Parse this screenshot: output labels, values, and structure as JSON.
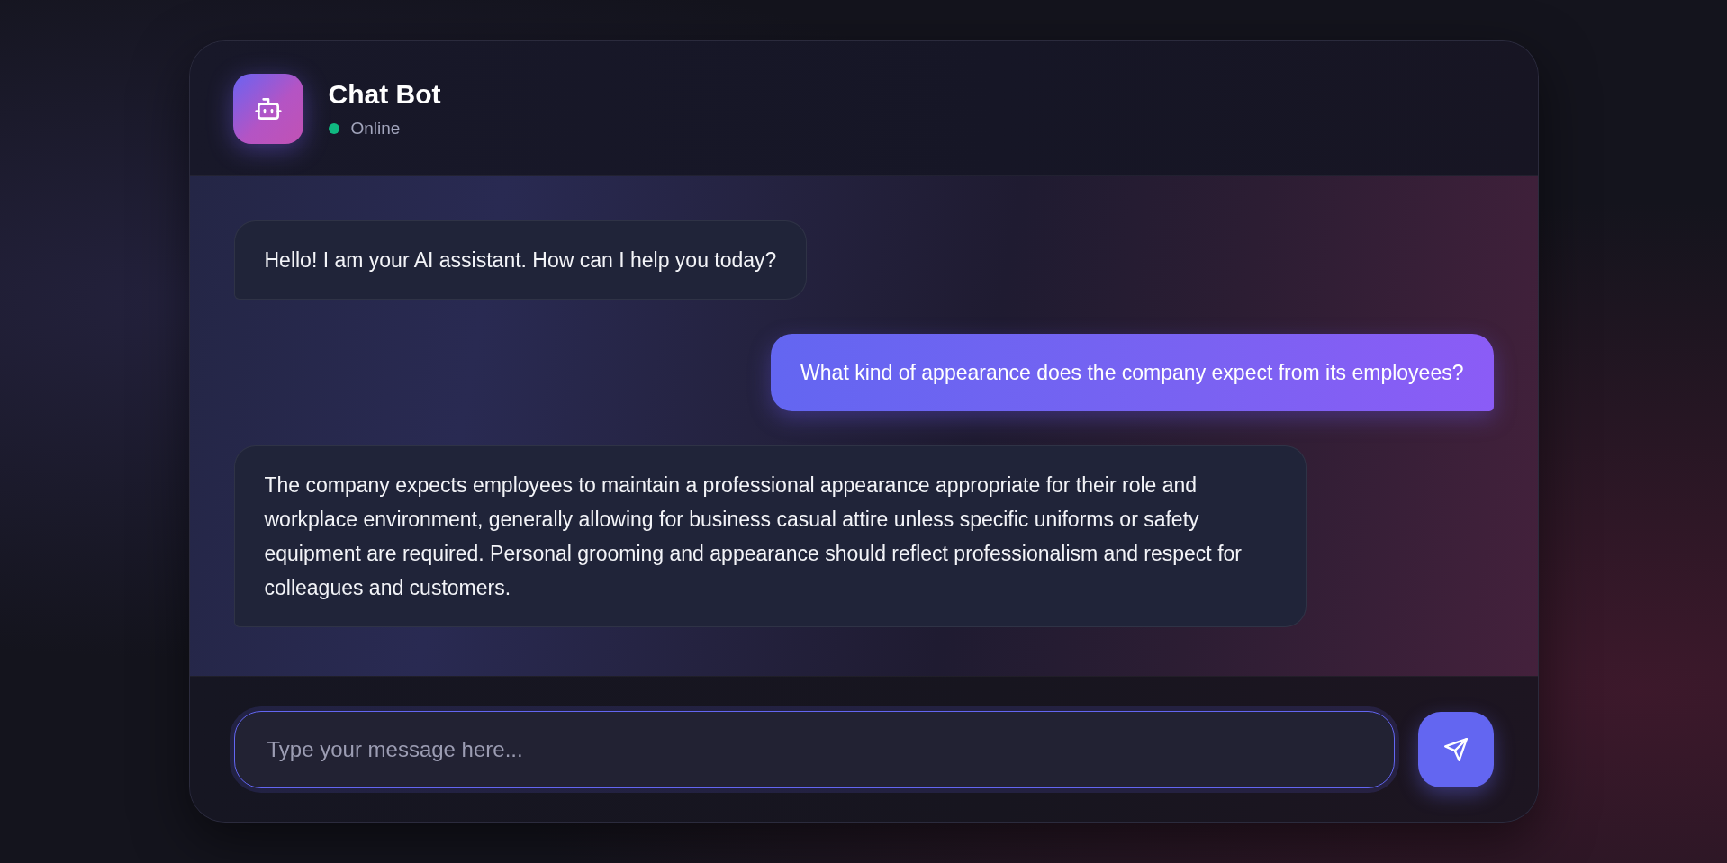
{
  "header": {
    "title": "Chat Bot",
    "status": {
      "label": "Online",
      "online": true
    }
  },
  "messages": [
    {
      "kind": "bot",
      "text": "Hello! I am your AI assistant. How can I help you today?"
    },
    {
      "kind": "user",
      "text": "What kind of appearance does the company expect from its employees?"
    },
    {
      "kind": "bot",
      "text": "The company expects employees to maintain a professional appearance appropriate for their role and workplace environment, generally allowing for business casual attire unless specific uniforms or safety equipment are required. Personal grooming and appearance should reflect professionalism and respect for colleagues and customers."
    }
  ],
  "composer": {
    "placeholder": "Type your message here..."
  }
}
